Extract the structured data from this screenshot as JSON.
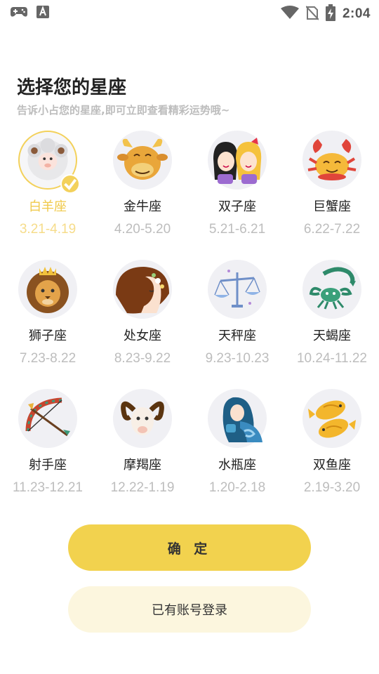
{
  "status_bar": {
    "time": "2:04",
    "icons": [
      "gamepad-icon",
      "font-a-icon",
      "wifi-icon",
      "no-sim-icon",
      "battery-charging-icon"
    ]
  },
  "header": {
    "title": "选择您的星座",
    "subtitle": "告诉小占您的星座,即可立即查看精彩运势哦~"
  },
  "zodiac": [
    {
      "name": "白羊座",
      "range": "3.21-4.19",
      "selected": true,
      "icon": "aries-sheep-icon"
    },
    {
      "name": "金牛座",
      "range": "4.20-5.20",
      "icon": "taurus-bull-icon"
    },
    {
      "name": "双子座",
      "range": "5.21-6.21",
      "icon": "gemini-twins-icon"
    },
    {
      "name": "巨蟹座",
      "range": "6.22-7.22",
      "icon": "cancer-crab-icon"
    },
    {
      "name": "狮子座",
      "range": "7.23-8.22",
      "icon": "leo-lion-icon"
    },
    {
      "name": "处女座",
      "range": "8.23-9.22",
      "icon": "virgo-maiden-icon"
    },
    {
      "name": "天秤座",
      "range": "9.23-10.23",
      "icon": "libra-scales-icon"
    },
    {
      "name": "天蝎座",
      "range": "10.24-11.22",
      "icon": "scorpio-scorpion-icon"
    },
    {
      "name": "射手座",
      "range": "11.23-12.21",
      "icon": "sagittarius-bow-icon"
    },
    {
      "name": "摩羯座",
      "range": "12.22-1.19",
      "icon": "capricorn-goat-icon"
    },
    {
      "name": "水瓶座",
      "range": "1.20-2.18",
      "icon": "aquarius-water-icon"
    },
    {
      "name": "双鱼座",
      "range": "2.19-3.20",
      "icon": "pisces-fish-icon"
    }
  ],
  "buttons": {
    "confirm": "确 定",
    "login": "已有账号登录"
  },
  "colors": {
    "accent": "#f2d24e",
    "accent_light": "#fcf6de",
    "selected_text": "#f0c94a",
    "muted": "#bdbdbd"
  }
}
